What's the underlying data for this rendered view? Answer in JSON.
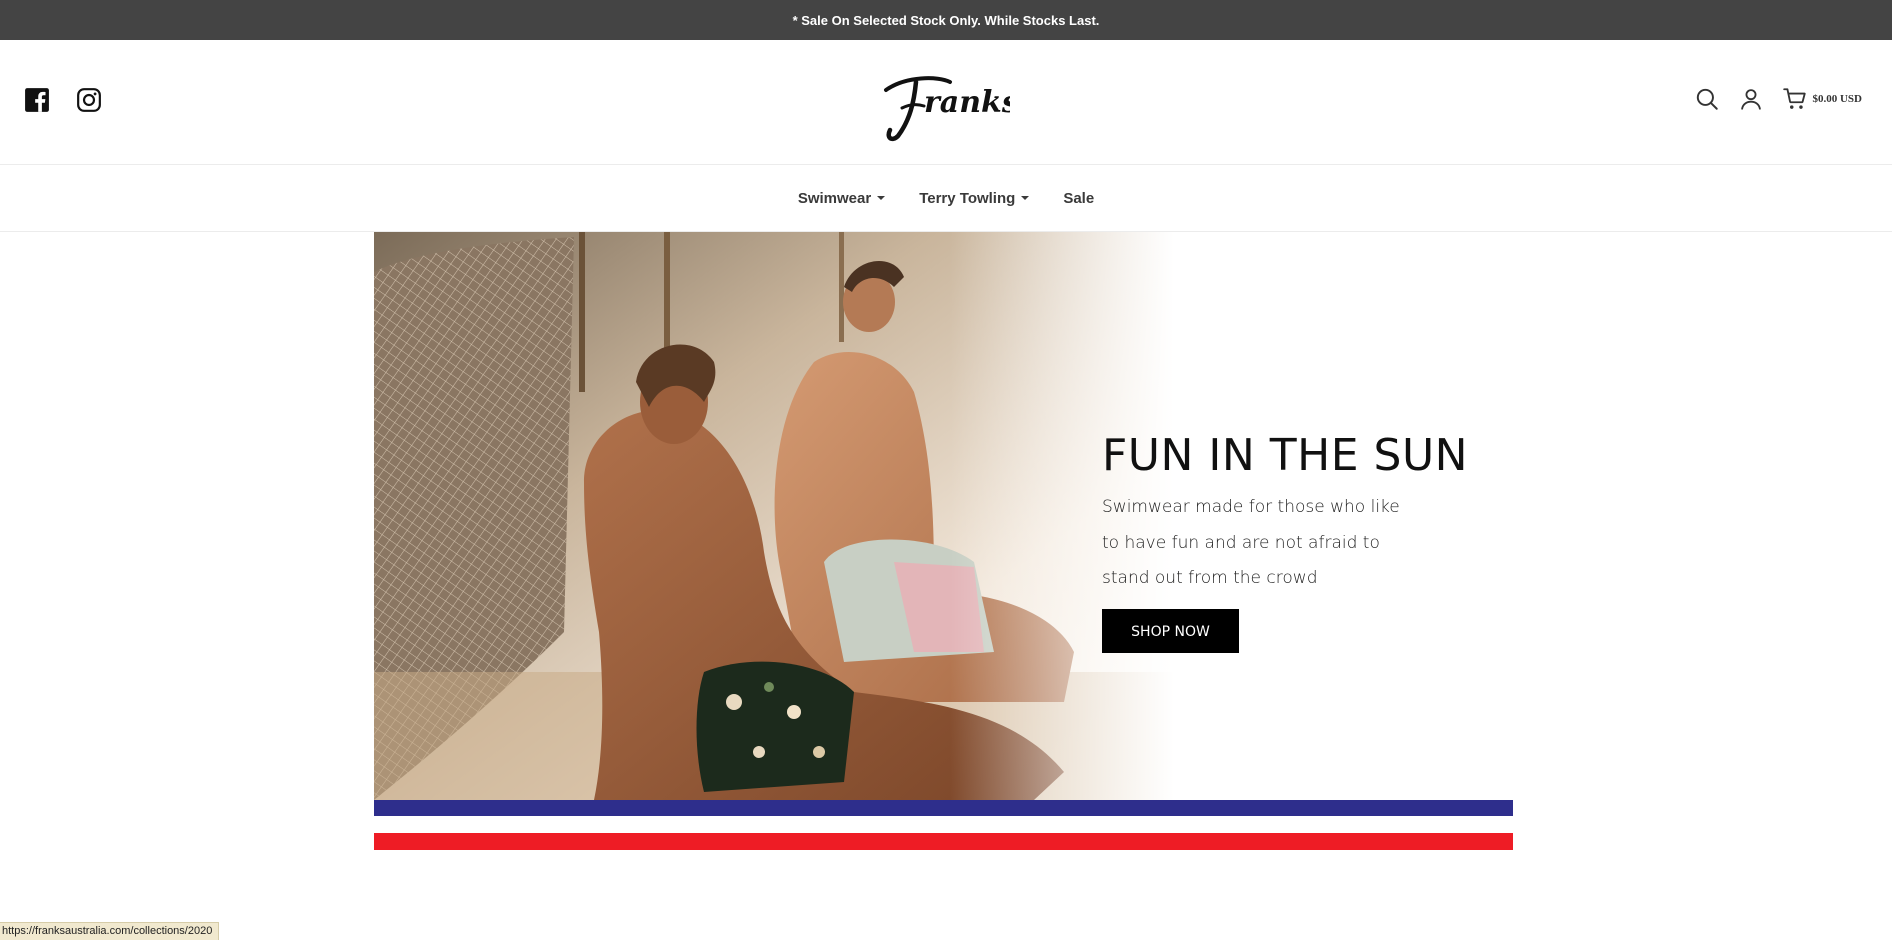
{
  "announcement": "* Sale On Selected Stock Only. While Stocks Last.",
  "header": {
    "social_icons": [
      "facebook-icon",
      "instagram-icon"
    ],
    "logo_text": "Franks",
    "tools_icons": [
      "search-icon",
      "account-icon",
      "cart-icon"
    ],
    "cart_total": "$0.00 USD"
  },
  "nav": {
    "items": [
      {
        "label": "Swimwear",
        "dropdown": true
      },
      {
        "label": "Terry Towling",
        "dropdown": true
      },
      {
        "label": "Sale",
        "dropdown": false
      }
    ]
  },
  "hero": {
    "title": "FUN IN THE SUN",
    "description_lines": [
      "Swimwear made for those who like",
      "to have fun and are not afraid to",
      "stand out from the crowd"
    ],
    "button_label": "SHOP NOW"
  },
  "stripes": {
    "colors": [
      "#2e2e8c",
      "#ffffff",
      "#ee1c25"
    ]
  },
  "status_bar": {
    "url": "https://franksaustralia.com/collections/2020"
  },
  "colors": {
    "announcement_bg": "#444444",
    "button_bg": "#000000"
  }
}
